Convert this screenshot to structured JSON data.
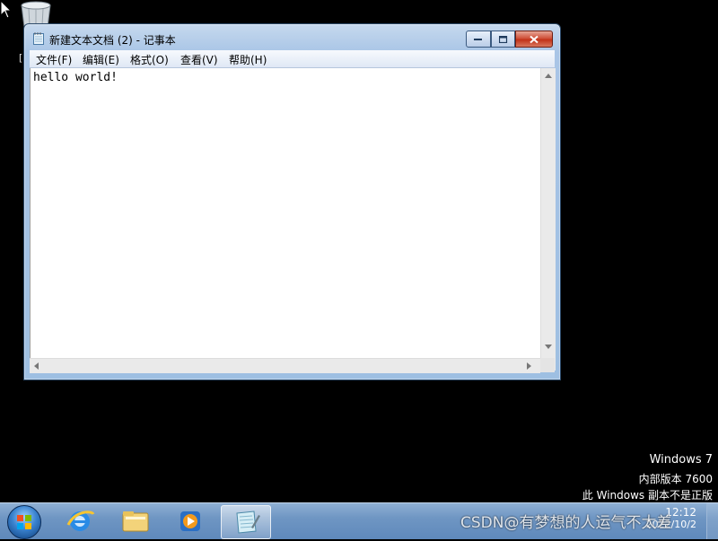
{
  "window": {
    "title": "新建文本文档 (2) - 记事本",
    "menus": [
      "文件(F)",
      "编辑(E)",
      "格式(O)",
      "查看(V)",
      "帮助(H)"
    ],
    "content": "hello world!"
  },
  "desktop": {
    "partial_label": "[",
    "watermark": {
      "line1": "Windows 7",
      "line2": "内部版本 7600",
      "line3": "此 Windows 副本不是正版"
    }
  },
  "taskbar": {
    "apps": [
      "start-button",
      "internet-explorer",
      "windows-explorer",
      "media-player",
      "notepad"
    ],
    "active_app": "notepad",
    "tray": {
      "prefix": "CSDN",
      "suffix_overlay": "@有梦想的人运气不太差",
      "time": "12:12",
      "date": "2022/10/2"
    }
  },
  "colors": {
    "desktop_bg": "#000000",
    "window_frame": "#a9c5e6",
    "close_button": "#c23218",
    "taskbar": "#6f96c3"
  }
}
